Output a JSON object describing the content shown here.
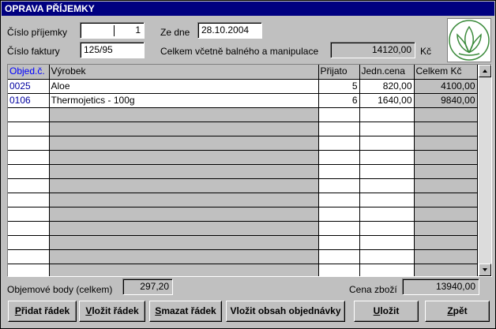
{
  "title": "OPRAVA PŘÍJEMKY",
  "form": {
    "receipt_no_label": "Číslo příjemky",
    "receipt_no_value": "1",
    "invoice_no_label": "Číslo faktury",
    "invoice_no_value": "125/95",
    "date_label": "Ze dne",
    "date_value": "28.10.2004",
    "total_label": "Celkem včetně balného a manipulace",
    "total_value": "14120,00",
    "total_currency": "Kč"
  },
  "table": {
    "columns": [
      "Objed.č.",
      "Výrobek",
      "Přijato",
      "Jedn.cena",
      "Celkem Kč"
    ],
    "rows": [
      [
        "0025",
        "Aloe",
        "5",
        "820,00",
        "4100,00"
      ],
      [
        "0106",
        "Thermojetics - 100g",
        "6",
        "1640,00",
        "9840,00"
      ]
    ]
  },
  "footer": {
    "volume_points_label": "Objemové body (celkem)",
    "volume_points_value": "297,20",
    "goods_price_label": "Cena zboží",
    "goods_price_value": "13940,00"
  },
  "buttons": {
    "add_row_ul": "P",
    "add_row_rest": "řidat řádek",
    "insert_row_ul": "V",
    "insert_row_rest": "ložit řádek",
    "delete_row_ul": "S",
    "delete_row_rest": "mazat řádek",
    "insert_order": "Vložit obsah objednávky",
    "save_ul": "U",
    "save_rest": "ložit",
    "back_ul": "Z",
    "back_rest": "pět"
  },
  "colors": {
    "title_bar": "#000080",
    "window": "#c0c0c0",
    "link_blue": "#0000ff"
  },
  "icons": {
    "logo": "herbalife-leaf-logo",
    "scroll_up": "arrow-up-icon",
    "scroll_down": "arrow-down-icon"
  }
}
